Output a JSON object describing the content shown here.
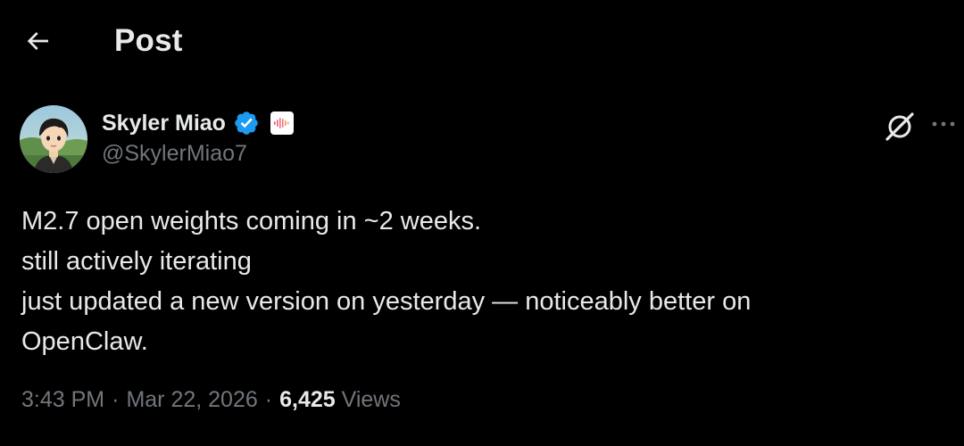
{
  "header": {
    "title": "Post"
  },
  "author": {
    "name": "Skyler Miao",
    "handle": "@SkylerMiao7"
  },
  "tweet": {
    "lines": [
      "M2.7 open weights coming in ~2 weeks.",
      "still actively iterating",
      "just updated a new version on yesterday — noticeably better on",
      "OpenClaw."
    ]
  },
  "meta": {
    "time": "3:43 PM",
    "separator": "·",
    "date": "Mar 22, 2026",
    "views_count": "6,425",
    "views_label": "Views"
  },
  "icons": {
    "back": "arrow-left-icon",
    "verified": "verified-badge-icon",
    "affiliate": "affiliate-badge-icon",
    "grok": "grok-icon",
    "more": "more-horizontal-icon"
  },
  "colors": {
    "background": "#000000",
    "text_primary": "#e7e9ea",
    "text_secondary": "#71767b",
    "verified_blue": "#1d9bf0"
  }
}
